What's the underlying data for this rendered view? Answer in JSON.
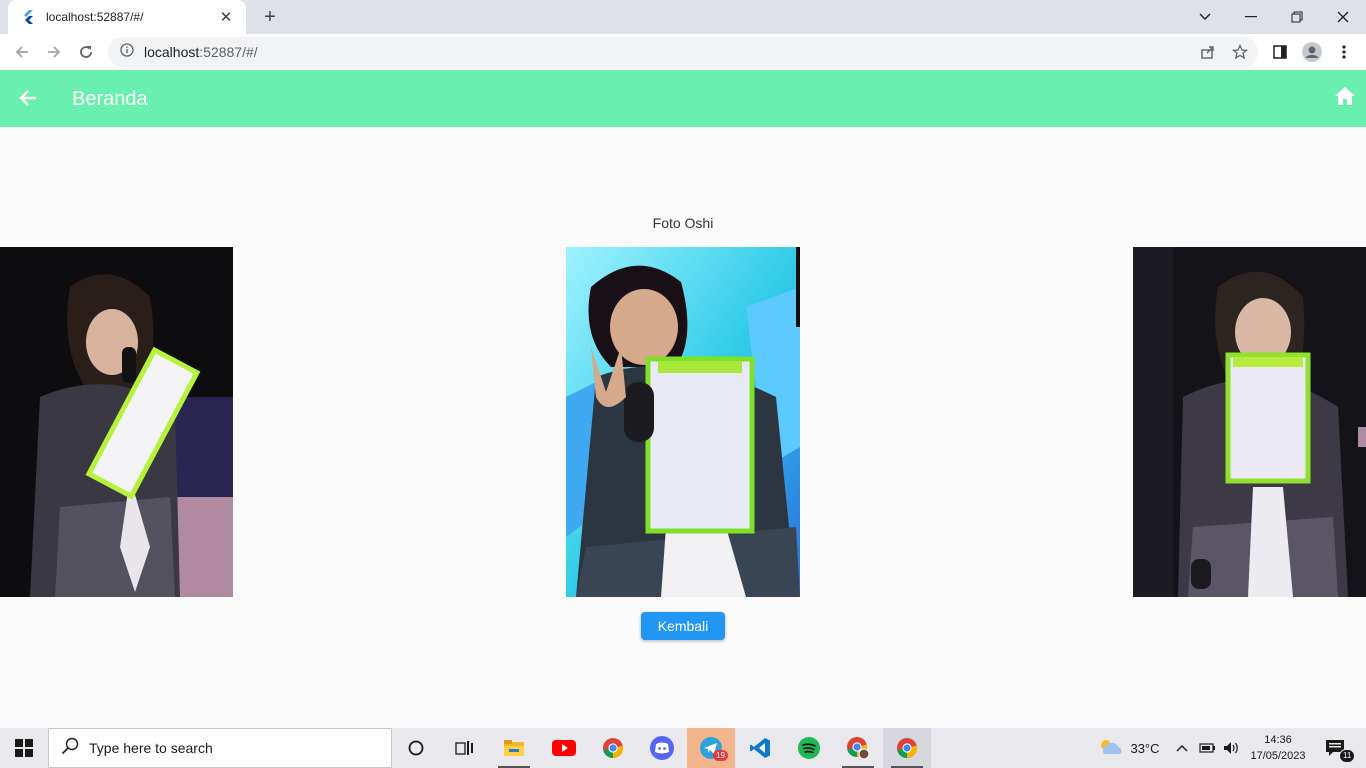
{
  "browser": {
    "tab_title": "localhost:52887/#/",
    "url_host": "localhost",
    "url_rest": ":52887/#/"
  },
  "appbar": {
    "title": "Beranda",
    "color": "#69f0ae"
  },
  "content": {
    "photo_label": "Foto Oshi",
    "back_button_label": "Kembali",
    "button_color": "#2196f3"
  },
  "taskbar": {
    "search_placeholder": "Type here to search",
    "weather": "33°C",
    "time": "14:36",
    "date": "17/05/2023",
    "telegram_badge": "19",
    "notifications_badge": "11"
  }
}
